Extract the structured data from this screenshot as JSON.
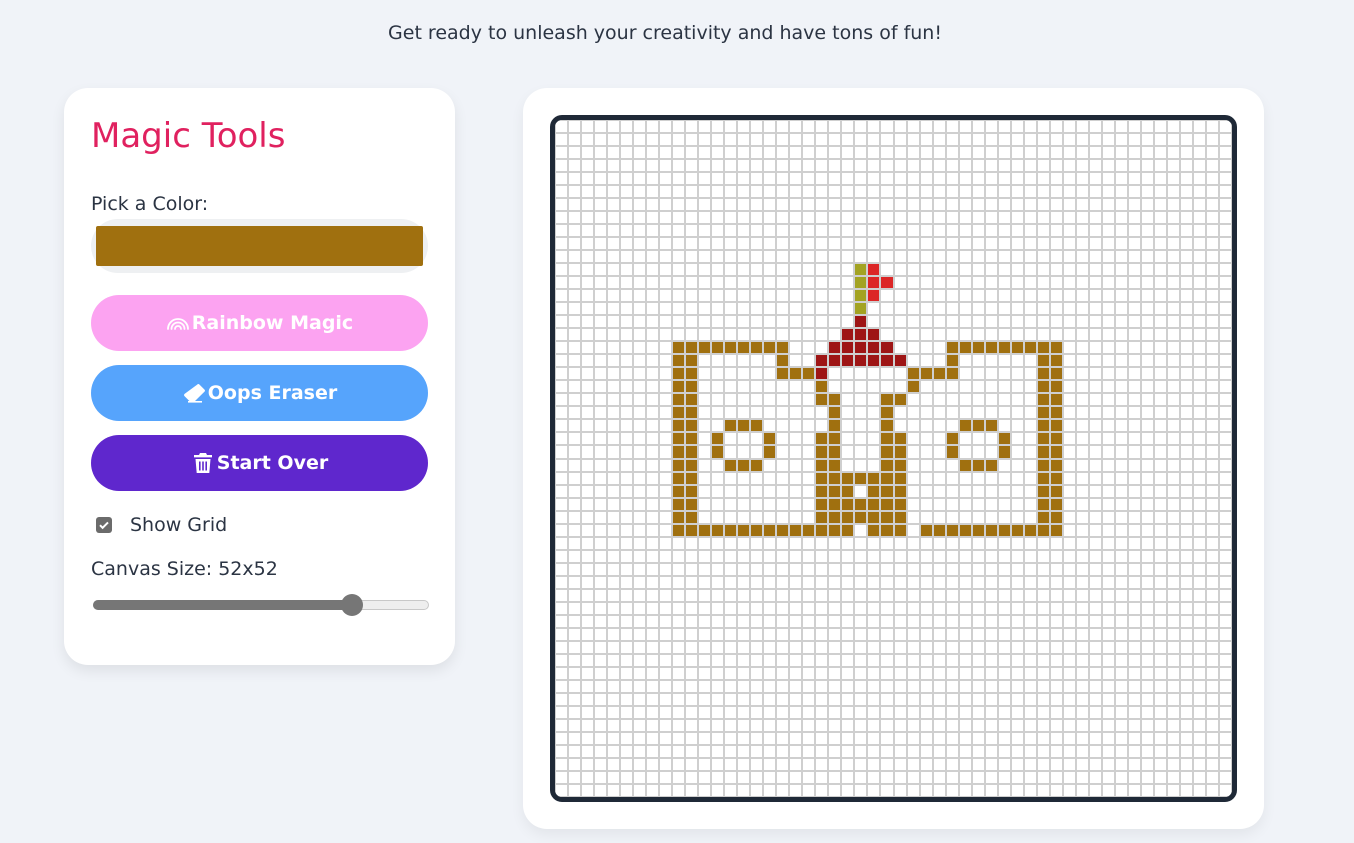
{
  "header": {
    "tagline": "Get ready to unleash your creativity and have tons of fun!"
  },
  "tools": {
    "title": "Magic Tools",
    "color_label": "Pick a Color:",
    "selected_color": "#a0700f",
    "rainbow_label": "Rainbow Magic",
    "rainbow_icon": "rainbow-icon",
    "eraser_label": "Oops Eraser",
    "eraser_icon": "eraser-icon",
    "clear_label": "Start Over",
    "clear_icon": "trash-icon",
    "show_grid_label": "Show Grid",
    "show_grid_checked": true,
    "canvas_size_label": "Canvas Size: 52x52",
    "canvas_size_value": 52,
    "canvas_size_fraction": 0.77
  },
  "colors": {
    "brown": "#a0700f",
    "darkred": "#9e1515",
    "red": "#dc2626",
    "olive": "#a3a322",
    "grid_line": "#cfcfcf"
  },
  "canvas": {
    "size": 52,
    "painted": [
      {
        "color": "brown",
        "rows": [
          [
            6,
            9,
            18
          ],
          [
            6,
            29,
            37
          ]
        ]
      },
      {
        "color": "brown",
        "rows": [
          [
            7,
            9,
            9
          ],
          [
            7,
            17,
            18
          ],
          [
            7,
            29,
            29
          ],
          [
            7,
            37,
            37
          ]
        ]
      }
    ]
  }
}
